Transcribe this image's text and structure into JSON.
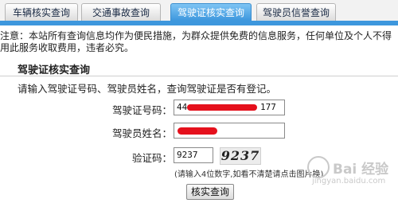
{
  "tabs": [
    {
      "label": "车辆核实查询",
      "active": false
    },
    {
      "label": "交通事故查询",
      "active": false
    },
    {
      "label": "驾驶证核实查询",
      "active": true
    },
    {
      "label": "驾驶员信誉查询",
      "active": false
    }
  ],
  "notice": {
    "line1": "注意：本站所有查询信息均作为便民措施，为群众提供免费的信息服务，任何单位及个人不得",
    "line2": "用此服务收取费用，违者必究。"
  },
  "section": {
    "title": "驾驶证核实查询",
    "instruction": "请输入驾驶证号码、驾驶员姓名，查询驾驶证是否有登记。"
  },
  "form": {
    "license_label": "驾驶证号码：",
    "license_value_prefix": "44",
    "license_value_suffix": "177",
    "name_label": "驾驶员姓名：",
    "code_label": "验证码：",
    "code_value": "9237",
    "captcha_text": "9237",
    "hint": "(请输入4位数字,如看不清楚请点击图片换)",
    "submit_label": "核实查询"
  },
  "watermark": {
    "brand": "Bai 经验",
    "url": "jingyan.baidu.com"
  },
  "colors": {
    "tab_active": "#3d97dd",
    "redaction": "#e5101c"
  }
}
